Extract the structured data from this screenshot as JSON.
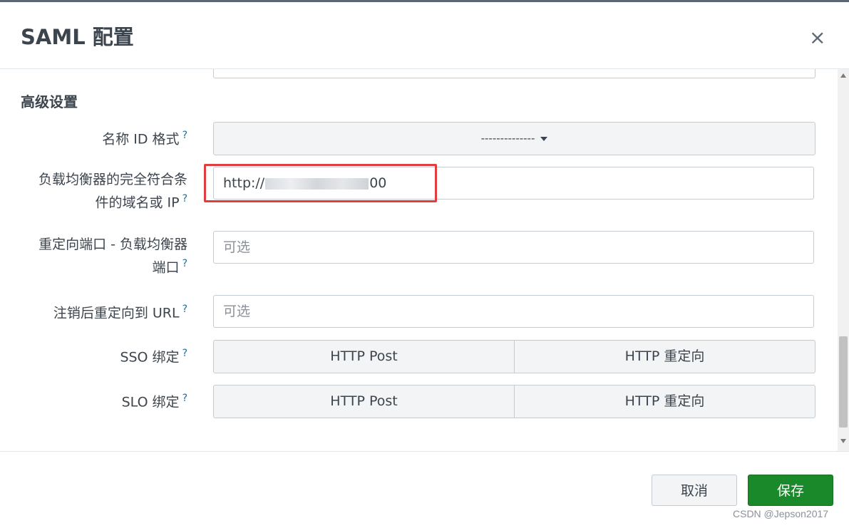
{
  "dialog": {
    "title": "SAML 配置",
    "close_icon": "×"
  },
  "section": {
    "title": "高级设置"
  },
  "help_marker": "?",
  "fields": {
    "name_id_format": {
      "label": "名称 ID 格式",
      "value": "--------------"
    },
    "lb_fqdn": {
      "label_line1": "负载均衡器的完全符合条",
      "label_line2": "件的域名或 IP",
      "value_prefix": "http://",
      "value_suffix": "00"
    },
    "redirect_port": {
      "label_line1": "重定向端口 - 负载均衡器",
      "label_line2": "端口",
      "placeholder": "可选"
    },
    "logout_url": {
      "label": "注销后重定向到 URL",
      "placeholder": "可选"
    },
    "sso_binding": {
      "label": "SSO 绑定",
      "options": [
        "HTTP Post",
        "HTTP 重定向"
      ]
    },
    "slo_binding": {
      "label": "SLO 绑定",
      "options": [
        "HTTP Post",
        "HTTP 重定向"
      ]
    }
  },
  "footer": {
    "cancel_label": "取消",
    "save_label": "保存"
  },
  "watermark": "CSDN @Jepson2017",
  "colors": {
    "save_button": "#1a8929",
    "highlight": "#e03e3e",
    "help_link": "#1a6fa0"
  }
}
